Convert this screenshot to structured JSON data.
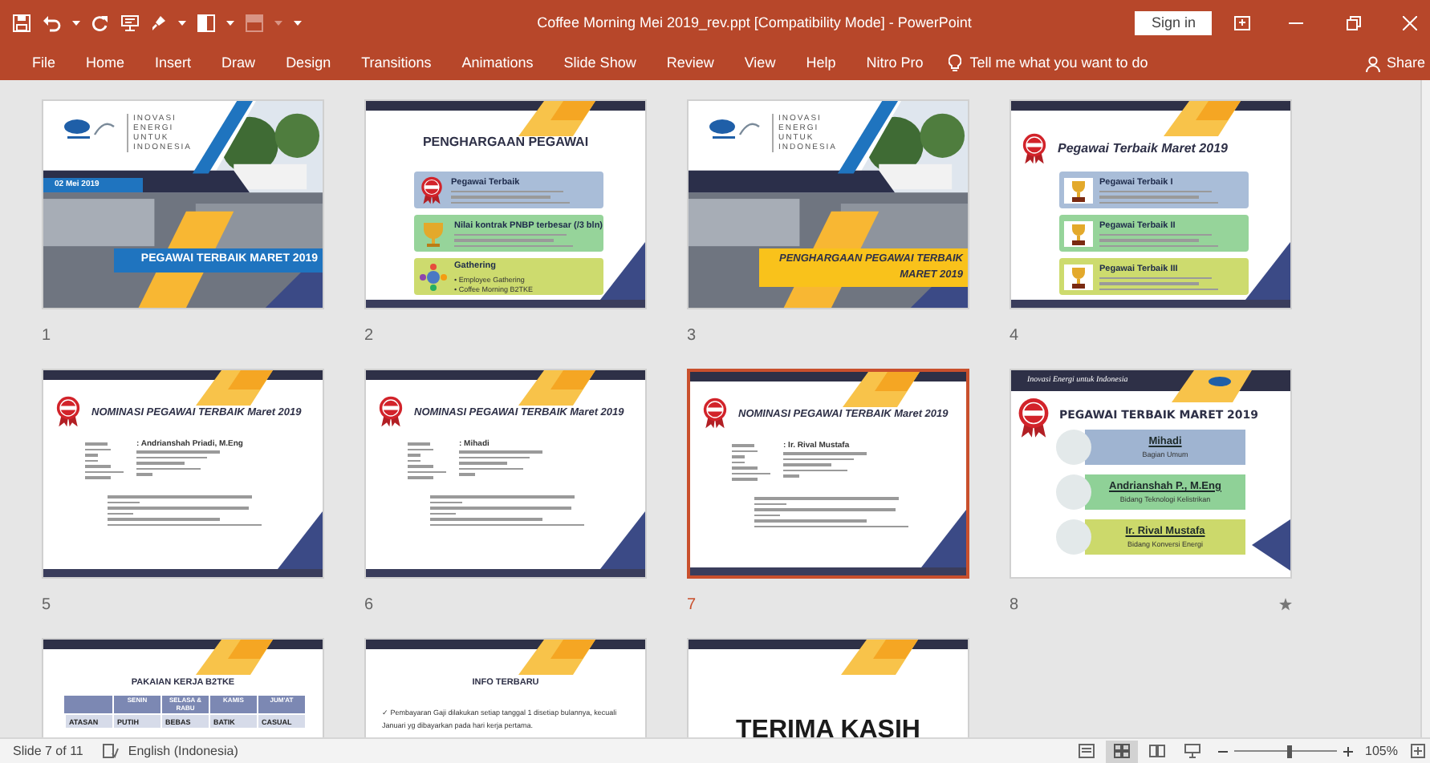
{
  "window": {
    "title": "Coffee Morning Mei 2019_rev.ppt [Compatibility Mode]  -  PowerPoint",
    "sign_in": "Sign in"
  },
  "ribbon_tabs": [
    "File",
    "Home",
    "Insert",
    "Draw",
    "Design",
    "Transitions",
    "Animations",
    "Slide Show",
    "Review",
    "View",
    "Help",
    "Nitro Pro"
  ],
  "tell_me": "Tell me what you want to do",
  "share": "Share",
  "slides": [
    {
      "number": "1",
      "selected": false,
      "animated": false,
      "kind": "cover",
      "color": "#1f74bf",
      "tagline": [
        "INOVASI",
        "ENERGI",
        "UNTUK",
        "INDONESIA"
      ],
      "date": "02 Mei 2019",
      "banner": [
        "PEGAWAI TERBAIK MARET 2019"
      ]
    },
    {
      "number": "2",
      "selected": false,
      "animated": false,
      "kind": "categories",
      "title": "PENGHARGAAN PEGAWAI",
      "cards": [
        {
          "title": "Pegawai Terbaik",
          "color": "#a9bdd8"
        },
        {
          "title": "Nilai kontrak PNBP terbesar (/3 bln)",
          "color": "#96d49a"
        },
        {
          "title": "Gathering",
          "color": "#cddb6e",
          "bullets": [
            "• Employee Gathering",
            "• Coffee Morning B2TKE"
          ]
        }
      ]
    },
    {
      "number": "3",
      "selected": false,
      "animated": false,
      "kind": "cover",
      "color": "#f9c21b",
      "tagline": [
        "INOVASI",
        "ENERGI",
        "UNTUK",
        "INDONESIA"
      ],
      "banner": [
        "PENGHARGAAN PEGAWAI TERBAIK",
        "MARET 2019"
      ]
    },
    {
      "number": "4",
      "selected": false,
      "animated": false,
      "kind": "awards",
      "title": "Pegawai Terbaik Maret 2019",
      "cards": [
        {
          "title": "Pegawai Terbaik I",
          "color": "#a9bdd8"
        },
        {
          "title": "Pegawai Terbaik II",
          "color": "#96d49a"
        },
        {
          "title": "Pegawai Terbaik III",
          "color": "#cddb6e"
        }
      ]
    },
    {
      "number": "5",
      "selected": false,
      "animated": false,
      "kind": "nominee",
      "title": "NOMINASI PEGAWAI TERBAIK Maret 2019",
      "name": ": Andrianshah Priadi, M.Eng"
    },
    {
      "number": "6",
      "selected": false,
      "animated": false,
      "kind": "nominee",
      "title": "NOMINASI PEGAWAI TERBAIK Maret 2019",
      "name": ": Mihadi"
    },
    {
      "number": "7",
      "selected": true,
      "animated": false,
      "kind": "nominee",
      "title": "NOMINASI PEGAWAI TERBAIK Maret 2019",
      "name": ": Ir. Rival Mustafa"
    },
    {
      "number": "8",
      "selected": false,
      "animated": true,
      "kind": "winners",
      "tagline": "Inovasi Energi untuk Indonesia",
      "title": "PEGAWAI TERBAIK MARET 2019",
      "winners": [
        {
          "name": "Mihadi",
          "unit": "Bagian Umum",
          "color": "#9fb4d1"
        },
        {
          "name": "Andrianshah P., M.Eng",
          "unit": "Bidang Teknologi Kelistrikan",
          "color": "#8fd197"
        },
        {
          "name": "Ir. Rival Mustafa",
          "unit": "Bidang Konversi Energi",
          "color": "#ccd96b"
        }
      ]
    },
    {
      "selected": false,
      "kind": "table",
      "title": "PAKAIAN KERJA B2TKE",
      "header": [
        "SENIN",
        "SELASA & RABU",
        "KAMIS",
        "JUM'AT"
      ],
      "row": [
        "ATASAN",
        "PUTIH",
        "BEBAS",
        "BATIK",
        "CASUAL"
      ]
    },
    {
      "selected": false,
      "kind": "info",
      "title": "INFO TERBARU",
      "text": "✓ Pembayaran Gaji dilakukan setiap tanggal 1 disetiap bulannya, kecuali Januari yg dibayarkan pada hari kerja pertama."
    },
    {
      "selected": false,
      "kind": "closing",
      "title": "TERIMA KASIH"
    }
  ],
  "status_bar": {
    "slide": "Slide 7 of 11",
    "language": "English (Indonesia)",
    "views": [
      {
        "selected": false
      },
      {
        "selected": true
      },
      {
        "selected": false
      },
      {
        "selected": false
      }
    ],
    "zoom": {
      "level": 0.55
    },
    "zoom_text": "105%"
  }
}
